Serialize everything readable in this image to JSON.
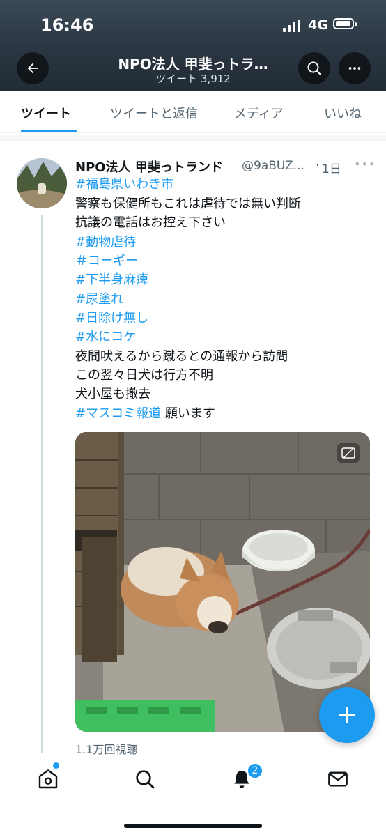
{
  "status_bar": {
    "time": "16:46",
    "network": "4G",
    "battery_percent": 80
  },
  "header": {
    "title": "NPO法人 甲斐っトラ…",
    "subtitle": "ツイート 3,912",
    "back_icon": "arrow-left-icon",
    "search_icon": "search-icon",
    "more_icon": "more-horizontal-icon"
  },
  "tabs": [
    {
      "label": "ツイート",
      "active": true
    },
    {
      "label": "ツイートと返信",
      "active": false
    },
    {
      "label": "メディア",
      "active": false
    },
    {
      "label": "いいね",
      "active": false
    }
  ],
  "tweet": {
    "author_name": "NPO法人 甲斐っトランド",
    "handle": "@9aBUZ...",
    "separator": "·",
    "time": "1日",
    "more": "•••",
    "lines": [
      "#福島県いわき市",
      "警察も保健所もこれは虐待では無い判断",
      "抗議の電話はお控え下さい",
      "#動物虐待",
      "＃コーギー",
      "#下半身麻痺",
      "#尿塗れ",
      "#日除け無し",
      "#水にコケ",
      "夜間吠えるから蹴るとの通報から訪問",
      "この翌々日犬は行方不明",
      "犬小屋も撤去"
    ],
    "last_line_tag": "#マスコミ報道",
    "last_line_text": " 願います",
    "views": "1.1万回視聴"
  },
  "fab": {
    "icon": "plus-icon"
  },
  "bottom_nav": {
    "items": [
      "home-icon",
      "search-icon",
      "bell-icon",
      "mail-icon"
    ],
    "notification_count": "2"
  },
  "colors": {
    "accent": "#1d9bf0",
    "text": "#0f1419",
    "muted": "#536471"
  }
}
